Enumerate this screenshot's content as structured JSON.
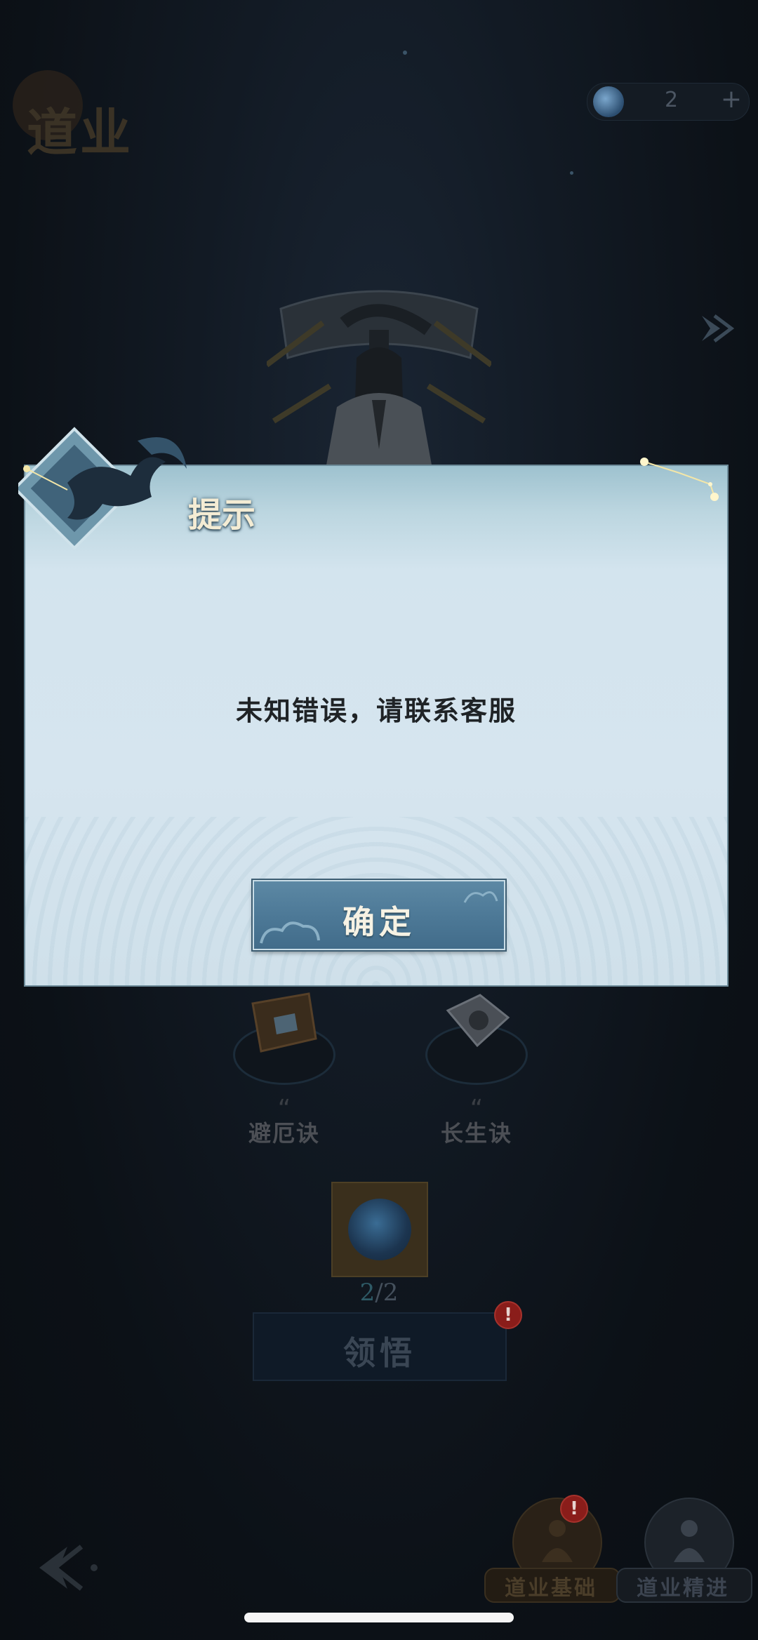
{
  "header": {
    "title": "道业",
    "currency": {
      "icon": "spirit-orb-icon",
      "count": "2",
      "add_label": "+"
    }
  },
  "dialog": {
    "title": "提示",
    "message": "未知错误，请联系客服",
    "confirm_label": "确定"
  },
  "skills": [
    {
      "name": "避厄诀",
      "quote": "“"
    },
    {
      "name": "长生诀",
      "quote": "“"
    }
  ],
  "reward": {
    "current": "2",
    "separator": "/",
    "total": "2"
  },
  "comprehend": {
    "label": "领悟",
    "badge": "!"
  },
  "nav": {
    "basic": {
      "label": "道业基础",
      "badge": "!"
    },
    "advanced": {
      "label": "道业精进"
    }
  },
  "colors": {
    "background": "#0c1016",
    "dialog_top": "#9ec2cf",
    "dialog_body": "#d6e5ef",
    "button": "#4c7896",
    "badge": "#8a1d1a"
  }
}
